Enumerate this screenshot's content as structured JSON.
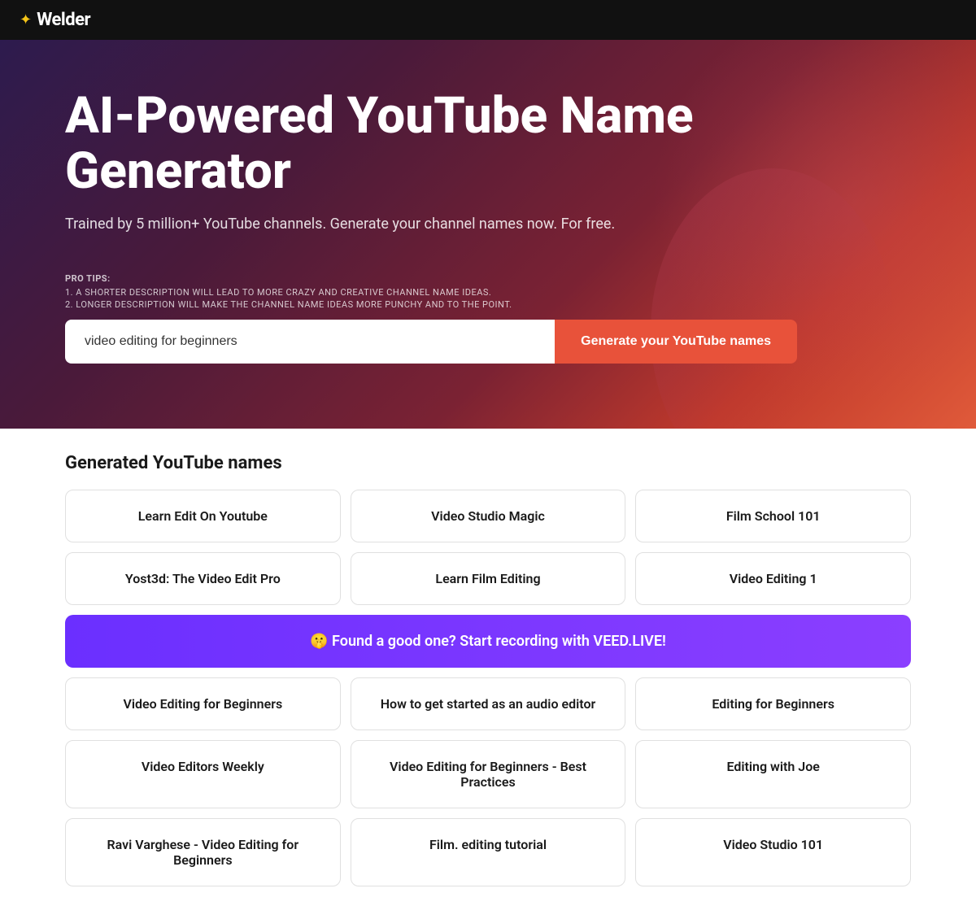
{
  "header": {
    "logo_icon": "✦",
    "logo_text": "Welder"
  },
  "hero": {
    "title": "AI-Powered YouTube Name Generator",
    "subtitle": "Trained by 5 million+ YouTube channels. Generate your channel names now. For free.",
    "pro_tips_label": "PRO TIPS:",
    "pro_tip_1": "1. A SHORTER DESCRIPTION WILL LEAD TO MORE CRAZY AND CREATIVE CHANNEL NAME IDEAS.",
    "pro_tip_2": "2. LONGER DESCRIPTION WILL MAKE THE CHANNEL NAME IDEAS MORE PUNCHY AND TO THE POINT.",
    "input_value": "video editing for beginners",
    "input_placeholder": "video editing for beginners",
    "generate_button": "Generate your YouTube names"
  },
  "results": {
    "title": "Generated YouTube names",
    "cta_banner": "🤫 Found a good one? Start recording with VEED.LIVE!",
    "names": [
      {
        "id": 1,
        "text": "Learn Edit On Youtube"
      },
      {
        "id": 2,
        "text": "Video Studio Magic"
      },
      {
        "id": 3,
        "text": "Film School 101"
      },
      {
        "id": 4,
        "text": "Yost3d: The Video Edit Pro"
      },
      {
        "id": 5,
        "text": "Learn Film Editing"
      },
      {
        "id": 6,
        "text": "Video Editing 1"
      },
      {
        "id": 7,
        "text": "Video Editing for Beginners"
      },
      {
        "id": 8,
        "text": "How to get started as an audio editor"
      },
      {
        "id": 9,
        "text": "Editing for Beginners"
      },
      {
        "id": 10,
        "text": "Video Editors Weekly"
      },
      {
        "id": 11,
        "text": "Video Editing for Beginners - Best Practices"
      },
      {
        "id": 12,
        "text": "Editing with Joe"
      },
      {
        "id": 13,
        "text": "Ravi Varghese - Video Editing for Beginners"
      },
      {
        "id": 14,
        "text": "Film. editing tutorial"
      },
      {
        "id": 15,
        "text": "Video Studio 101"
      }
    ]
  }
}
